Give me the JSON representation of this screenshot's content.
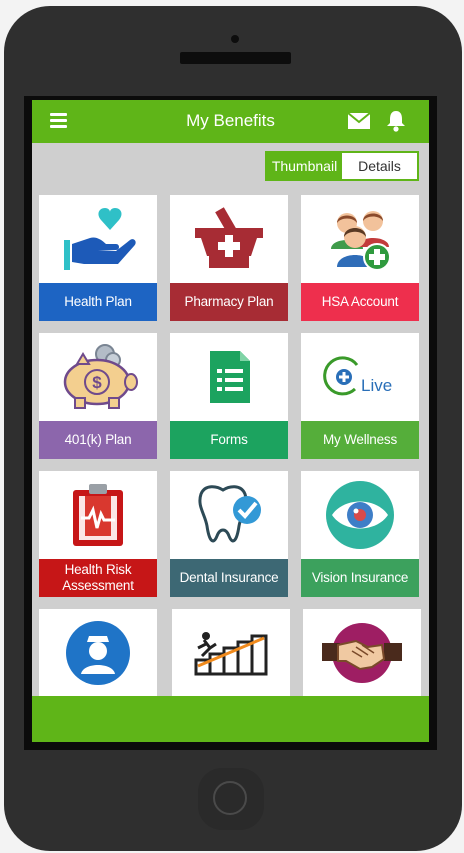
{
  "app": {
    "title": "My Benefits"
  },
  "header": {
    "menu_icon": "hamburger-icon",
    "mail_icon": "envelope-icon",
    "notification_icon": "bell-icon"
  },
  "view_toggle": {
    "thumbnail_label": "Thumbnail",
    "details_label": "Details",
    "selected": "Thumbnail"
  },
  "tiles": [
    {
      "label": "Health Plan",
      "color": "#1d64c3",
      "icon": "hand-heart-icon"
    },
    {
      "label": "Pharmacy Plan",
      "color": "#a72c34",
      "icon": "mortar-pestle-icon"
    },
    {
      "label": "HSA Account",
      "color": "#ee2f4d",
      "icon": "people-add-icon"
    },
    {
      "label": "401(k) Plan",
      "color": "#8c66ac",
      "icon": "piggy-bank-icon"
    },
    {
      "label": "Forms",
      "color": "#1ca35f",
      "icon": "document-form-icon"
    },
    {
      "label": "My Wellness",
      "color": "#55ae3a",
      "icon": "plus-live-icon",
      "icon_text": "Live"
    },
    {
      "label": "Health Risk Assessment",
      "color": "#c61617",
      "icon": "heart-monitor-clipboard-icon"
    },
    {
      "label": "Dental Insurance",
      "color": "#3d6874",
      "icon": "tooth-check-icon"
    },
    {
      "label": "Vision Insurance",
      "color": "#3ca15d",
      "icon": "eye-icon"
    },
    {
      "label": "",
      "color": "#ffffff",
      "icon": "nurse-icon"
    },
    {
      "label": "",
      "color": "#ffffff",
      "icon": "stairs-runner-icon"
    },
    {
      "label": "",
      "color": "#ffffff",
      "icon": "handshake-icon"
    }
  ],
  "colors": {
    "brand_green": "#5fb518",
    "phone_body": "#2f2f2f",
    "app_background": "#cfcfcf"
  }
}
